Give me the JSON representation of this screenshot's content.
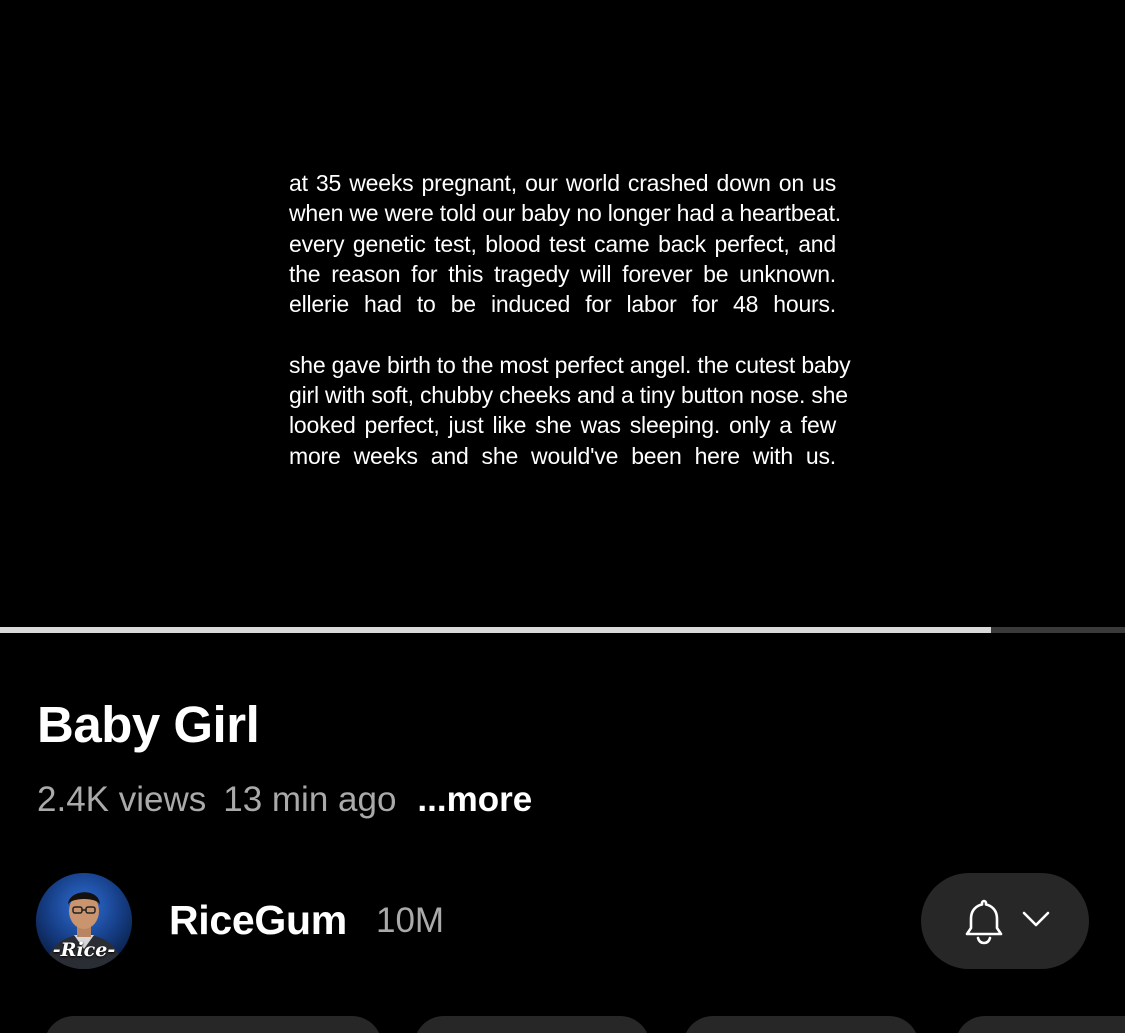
{
  "video": {
    "caption": {
      "paragraph1": [
        "at 35 weeks pregnant, our world crashed down on us",
        "when we were told our baby no longer had a heartbeat.",
        "every genetic test, blood test came back perfect, and",
        "the reason for this tragedy will forever be unknown.",
        "ellerie had to be induced for labor for 48 hours."
      ],
      "paragraph2": [
        "she gave birth to the most perfect angel. the cutest baby",
        "girl with soft, chubby cheeks and a tiny button nose. she",
        "looked perfect, just like she was sleeping. only a few",
        "more weeks and she would've been here with us."
      ]
    },
    "progress_fraction": 0.881
  },
  "title": "Baby Girl",
  "meta": {
    "views": "2.4K views",
    "age": "13 min ago",
    "more_label": "...more"
  },
  "channel": {
    "name": "RiceGum",
    "subscribers": "10M",
    "avatar_watermark": "-Rice-"
  },
  "subscribe": {
    "bell_icon": "bell-icon",
    "chevron_icon": "chevron-down-icon"
  },
  "colors": {
    "background": "#000000",
    "secondary_text": "#aaaaaa",
    "button_bg": "#272727",
    "progress_played": "#d9d9d9",
    "progress_track": "#3a3a3a"
  }
}
